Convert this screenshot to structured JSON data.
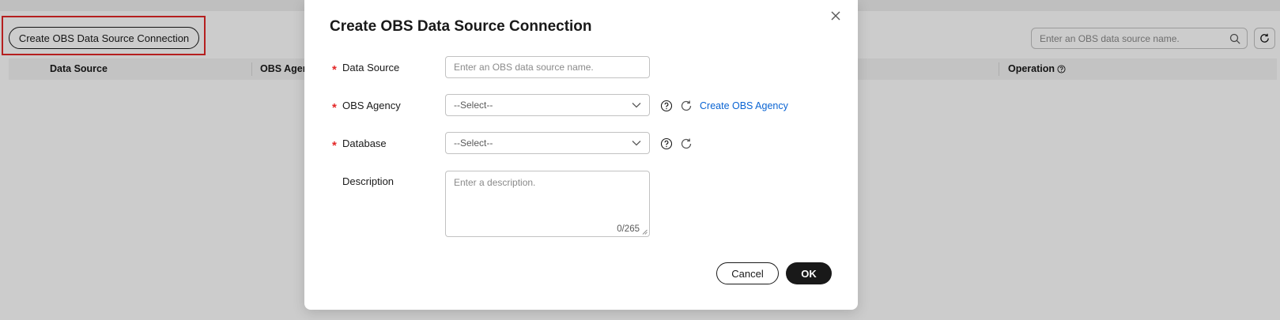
{
  "background": {
    "create_button_label": "Create OBS Data Source Connection",
    "search_placeholder": "Enter an OBS data source name.",
    "table_headers": {
      "data_source": "Data Source",
      "obs_agency": "OBS Agen",
      "operation": "Operation"
    }
  },
  "dialog": {
    "title": "Create OBS Data Source Connection",
    "fields": {
      "data_source": {
        "label": "Data Source",
        "placeholder": "Enter an OBS data source name.",
        "required": true
      },
      "obs_agency": {
        "label": "OBS Agency",
        "value": "--Select--",
        "required": true,
        "link": "Create OBS Agency"
      },
      "database": {
        "label": "Database",
        "value": "--Select--",
        "required": true
      },
      "description": {
        "label": "Description",
        "placeholder": "Enter a description.",
        "counter": "0/265",
        "required": false
      }
    },
    "required_mark": "*",
    "buttons": {
      "cancel": "Cancel",
      "ok": "OK"
    }
  },
  "colors": {
    "accent_link": "#0a64d3",
    "required": "#e32727",
    "highlight": "#e32727",
    "primary_button": "#191919"
  }
}
